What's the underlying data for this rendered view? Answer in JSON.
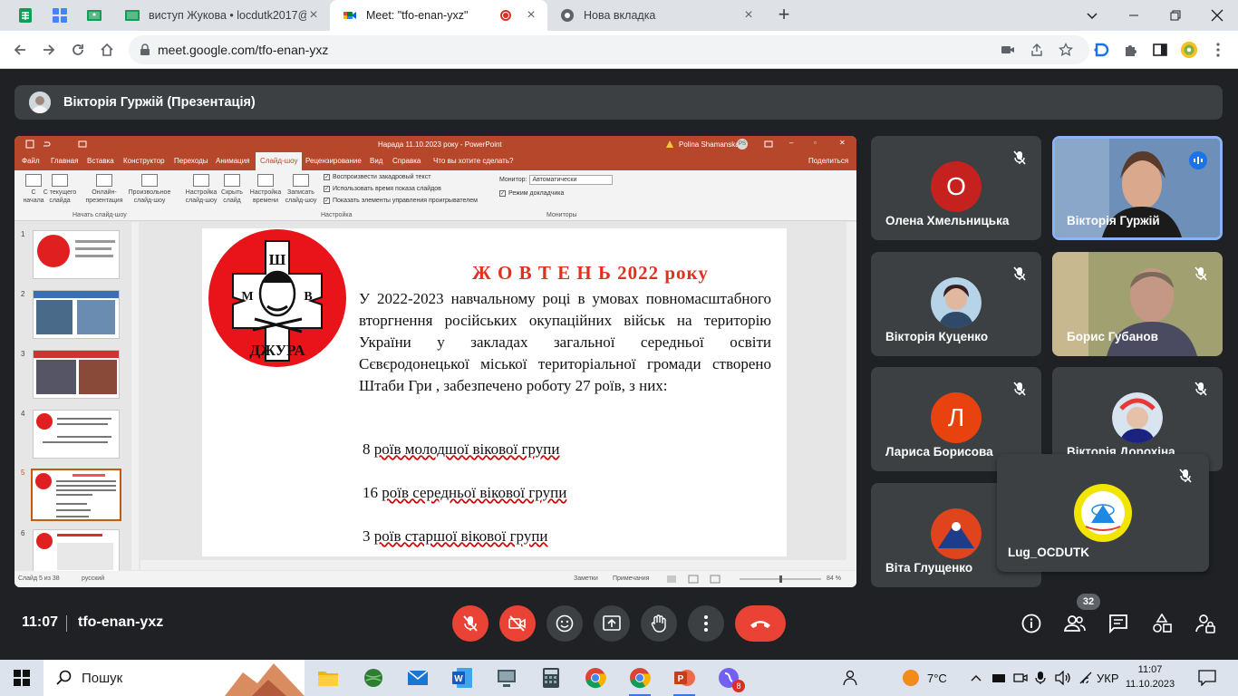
{
  "browser": {
    "tabs": [
      {
        "title": "виступ Жукова • locdutk2017@"
      },
      {
        "title": "Meet: \"tfo-enan-yxz\"",
        "active": true
      },
      {
        "title": "Нова вкладка"
      }
    ],
    "url": "meet.google.com/tfo-enan-yxz"
  },
  "meet": {
    "presenter_label": "Вікторія Гуржій (Презентація)",
    "time": "11:07",
    "meeting_code": "tfo-enan-yxz",
    "participant_count": "32",
    "participants": [
      {
        "name": "Олена Хмельницька",
        "initial": "О",
        "color": "#c5221f"
      },
      {
        "name": "Вікторія Гуржій"
      },
      {
        "name": "Вікторія Куценко"
      },
      {
        "name": "Борис Губанов"
      },
      {
        "name": "Лариса Борисова",
        "initial": "Л",
        "color": "#e8430f"
      },
      {
        "name": "Вікторія Дорохіна"
      },
      {
        "name": "Віта Глущенко"
      },
      {
        "name": "Lug_OCDUTK"
      }
    ]
  },
  "ppt": {
    "title": "Нарада 11.10.2023 року - PowerPoint",
    "user": "Polina Shamanska",
    "user_initials": "PS",
    "menu": [
      "Файл",
      "Главная",
      "Вставка",
      "Конструктор",
      "Переходы",
      "Анимация",
      "Слайд-шоу",
      "Рецензирование",
      "Вид",
      "Справка",
      "Что вы хотите сделать?"
    ],
    "share": "Поделиться",
    "ribbon": {
      "from_start": "С начала",
      "from_current": "С текущего слайда",
      "online": "Онлайн-презентация",
      "custom": "Произвольное слайд-шоу",
      "group1": "Начать слайд-шоу",
      "setup": "Настройка слайд-шоу",
      "hide": "Скрыть слайд",
      "timings": "Настройка времени",
      "record": "Записать слайд-шоу",
      "chk1": "Воспроизвести закадровый текст",
      "chk2": "Использовать время показа слайдов",
      "chk3": "Показать элементы управления проигрывателем",
      "group2": "Настройка",
      "monitor_label": "Монитор:",
      "monitor_value": "Автоматически",
      "presenter_view": "Режим докладчика",
      "group3": "Мониторы"
    },
    "thumb_numbers": [
      "1",
      "2",
      "3",
      "4",
      "5",
      "6"
    ],
    "status_slide": "Слайд 5 из 38",
    "status_lang": "русский",
    "status_notes": "Заметки",
    "status_comments": "Примечания",
    "zoom": "84 %"
  },
  "slide": {
    "logo_text": "ДЖУРА",
    "logo_letters": [
      "Ш",
      "М",
      "В"
    ],
    "title": "Ж О В Т Е Н Ь  2022 року",
    "body": "У 2022-2023 навчальному році в умовах повномасштабного вторгнення російських окупаційних військ на територію України у закладах загальної середньої освіти Сєвєродонецької міської територіальної громади створено Штаби Гри , забезпечено роботу 27 роїв, з них:",
    "lines": [
      {
        "num": "8",
        "text": "роїв молодшої вікової групи"
      },
      {
        "num": "16",
        "text": "роїв  середньої вікової групи"
      },
      {
        "num": "3",
        "text": "роїв старшої   вікової  групи"
      }
    ]
  },
  "taskbar": {
    "search_label": "Пошук",
    "weather": "7°C",
    "lang": "УКР",
    "time": "11:07",
    "date": "11.10.2023",
    "notif_badge": "8"
  }
}
